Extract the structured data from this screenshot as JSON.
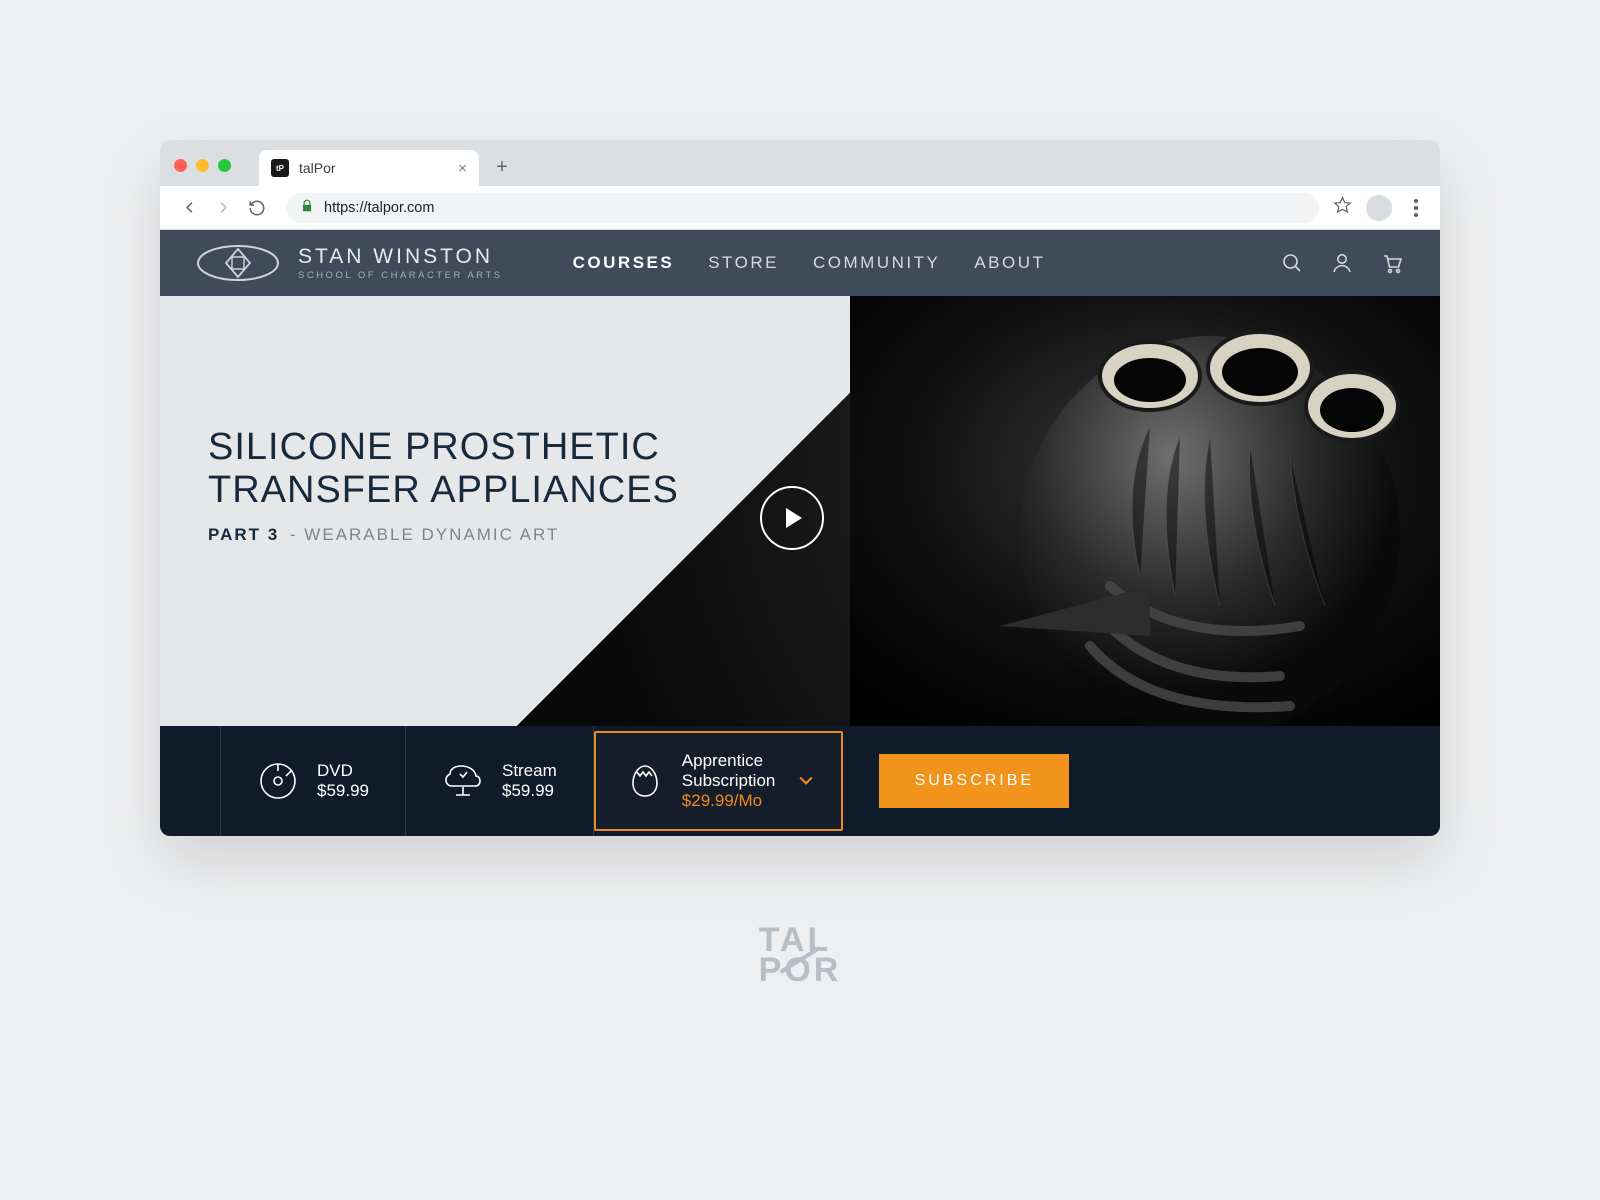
{
  "browser": {
    "tab_title": "talPor",
    "url_prefix": "https://",
    "url_host": "talpor.com"
  },
  "header": {
    "brand_line1": "STAN WINSTON",
    "brand_line2": "SCHOOL OF CHARACTER ARTS",
    "nav": {
      "courses": "COURSES",
      "store": "STORE",
      "community": "COMMUNITY",
      "about": "ABOUT"
    }
  },
  "hero": {
    "title_line1": "SILICONE PROSTHETIC",
    "title_line2": "TRANSFER APPLIANCES",
    "part_label": "PART 3",
    "subtitle": " - WEARABLE DYNAMIC ART"
  },
  "pricing": {
    "dvd": {
      "label": "DVD",
      "price": "$59.99"
    },
    "stream": {
      "label": "Stream",
      "price": "$59.99"
    },
    "apprentice": {
      "label1": "Apprentice",
      "label2": "Subscription",
      "price": "$29.99/Mo"
    },
    "subscribe_label": "SUBSCRIBE"
  },
  "footer_brand": {
    "line1": "TAL",
    "line2": "POR"
  },
  "colors": {
    "accent": "#f2941b",
    "header_bg": "#3f4a5a",
    "dark": "#0f1a2b"
  }
}
